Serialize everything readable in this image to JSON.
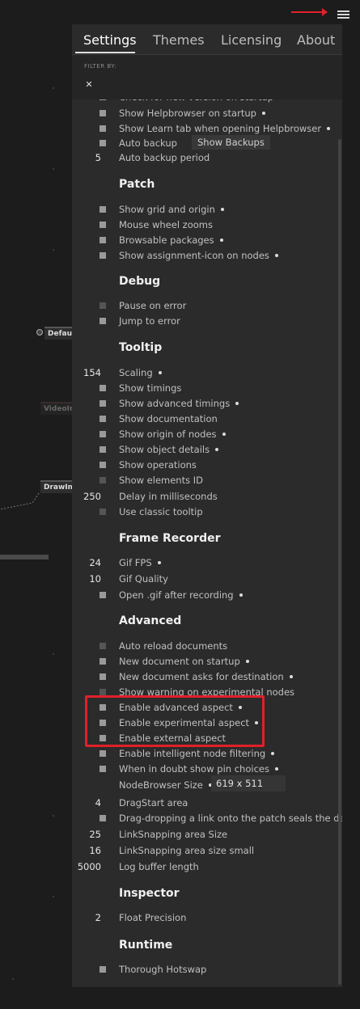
{
  "tabs": [
    "Settings",
    "Themes",
    "Licensing",
    "About"
  ],
  "filter": {
    "label": "FILTER BY:",
    "clear": "✕"
  },
  "bg_nodes": {
    "default": "Defaul",
    "video": "VideoIn",
    "draw": "DrawIm"
  },
  "general": [
    {
      "label": "Check for new version on startup",
      "checkbox": true
    },
    {
      "label": "Show Helpbrowser on startup",
      "checkbox": true,
      "dot": true
    },
    {
      "label": "Show Learn tab when opening Helpbrowser",
      "checkbox": true,
      "dot": true
    },
    {
      "label": "Auto backup",
      "checkbox": true,
      "button": "Show Backups"
    },
    {
      "label": "Auto backup period",
      "value": "5"
    }
  ],
  "sections": {
    "patch": "Patch",
    "debug": "Debug",
    "tooltip": "Tooltip",
    "frame_recorder": "Frame Recorder",
    "advanced": "Advanced",
    "inspector": "Inspector",
    "runtime": "Runtime"
  },
  "patch": [
    {
      "label": "Show grid and origin",
      "dot": true
    },
    {
      "label": "Mouse wheel zooms"
    },
    {
      "label": "Browsable packages",
      "dot": true
    },
    {
      "label": "Show assignment-icon on nodes",
      "dot": true
    }
  ],
  "debug": [
    {
      "label": "Pause on error"
    },
    {
      "label": "Jump to error"
    }
  ],
  "tooltip": [
    {
      "label": "Scaling",
      "value": "154",
      "dot": true
    },
    {
      "label": "Show timings"
    },
    {
      "label": "Show advanced timings",
      "dot": true
    },
    {
      "label": "Show documentation"
    },
    {
      "label": "Show origin of nodes",
      "dot": true
    },
    {
      "label": "Show object details",
      "dot": true
    },
    {
      "label": "Show operations"
    },
    {
      "label": "Show elements ID"
    },
    {
      "label": "Delay in milliseconds",
      "value": "250"
    },
    {
      "label": "Use classic tooltip"
    }
  ],
  "frame_recorder": [
    {
      "label": "Gif FPS",
      "value": "24",
      "dot": true
    },
    {
      "label": "Gif Quality",
      "value": "10"
    },
    {
      "label": "Open .gif after recording",
      "dot": true
    }
  ],
  "advanced": [
    {
      "label": "Auto reload documents"
    },
    {
      "label": "New document on startup",
      "dot": true
    },
    {
      "label": "New document asks for destination",
      "dot": true
    },
    {
      "label": "Show warning on experimental nodes"
    },
    {
      "label": "Enable advanced aspect",
      "dot": true
    },
    {
      "label": "Enable experimental aspect",
      "dot": true
    },
    {
      "label": "Enable external aspect"
    },
    {
      "label": "Enable intelligent node filtering",
      "dot": true
    },
    {
      "label": "When in doubt show pin choices",
      "dot": true
    },
    {
      "label": "NodeBrowser Size",
      "dot": true,
      "field": "619 x 511"
    },
    {
      "label": "DragStart area",
      "value": "4"
    },
    {
      "label": "Drag-dropping a link onto the patch seals the deal"
    },
    {
      "label": "LinkSnapping area Size",
      "value": "25"
    },
    {
      "label": "LinkSnapping area size small",
      "value": "16"
    },
    {
      "label": "Log buffer length",
      "value": "5000"
    }
  ],
  "inspector": [
    {
      "label": "Float Precision",
      "value": "2"
    }
  ],
  "runtime": [
    {
      "label": "Thorough Hotswap"
    }
  ],
  "colors": {
    "accent_red": "#e0202a",
    "panel": "#2b2b2b",
    "background": "#1c1c1c"
  }
}
